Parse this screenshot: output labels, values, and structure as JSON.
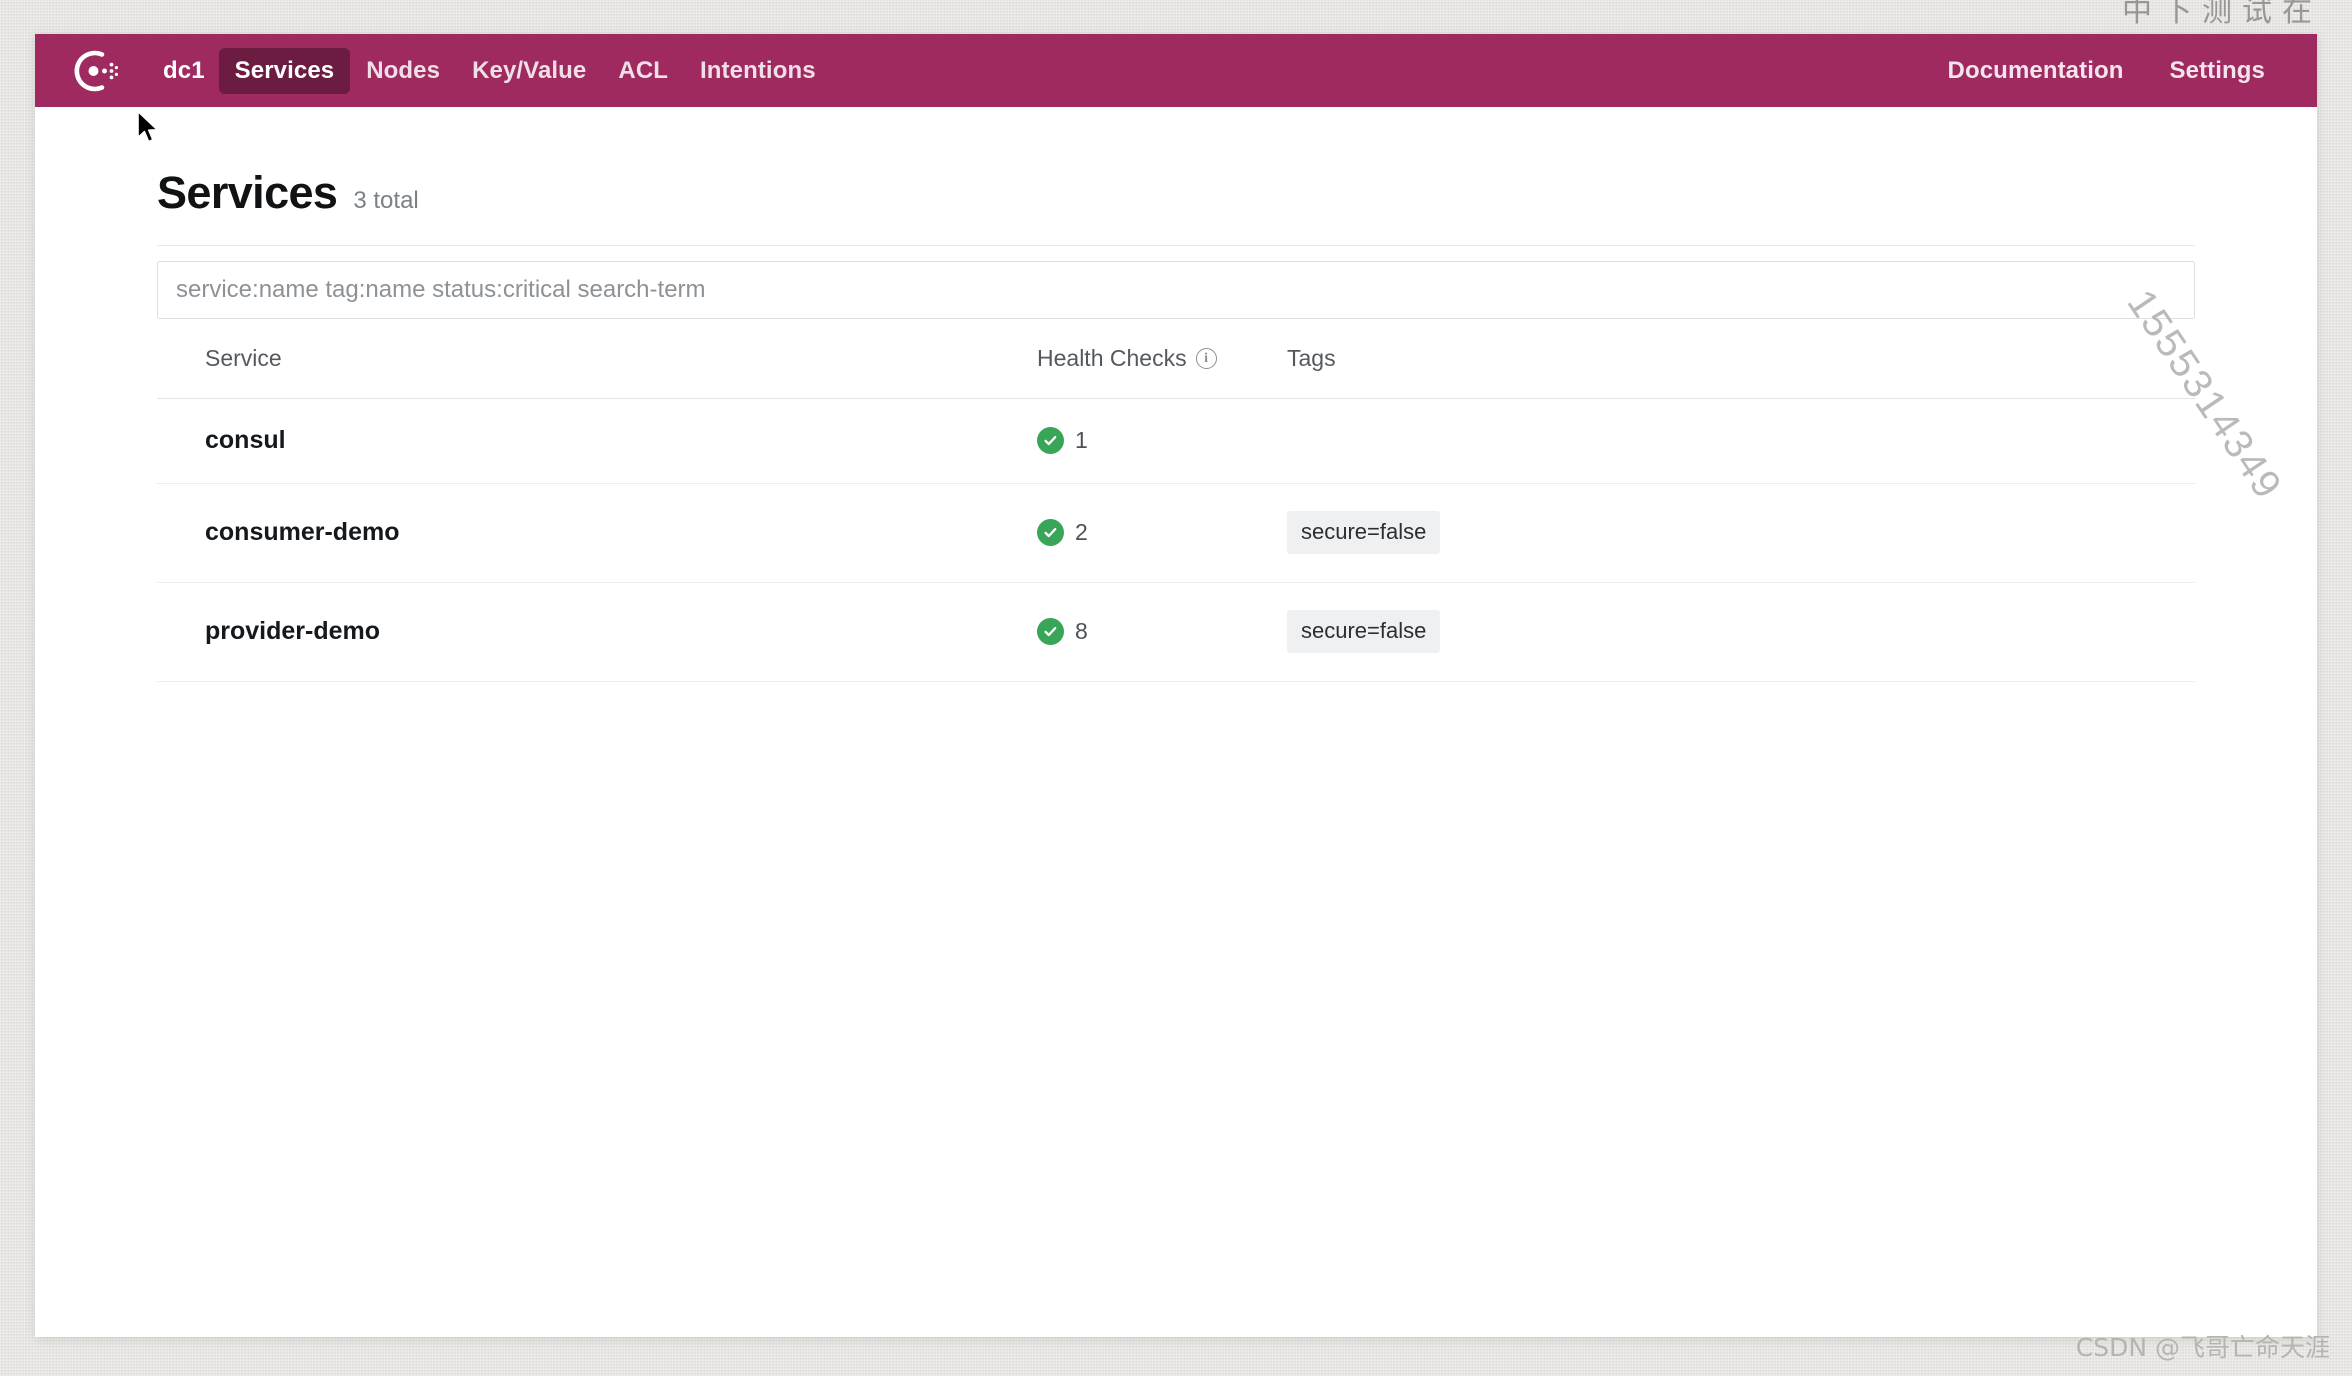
{
  "desktop": {
    "top_cutoff_text": "中下测试在",
    "watermark_diagonal": "1555314349",
    "watermark_footer": "CSDN @飞哥亡命天涯",
    "background_color": "#e3e1dd"
  },
  "navbar": {
    "brand_icon": "consul-logo-icon",
    "background_color": "#9e2a5f",
    "active_background_color": "#6d1c41",
    "datacenter": "dc1",
    "items": [
      {
        "label": "Services",
        "active": true
      },
      {
        "label": "Nodes",
        "active": false
      },
      {
        "label": "Key/Value",
        "active": false
      },
      {
        "label": "ACL",
        "active": false
      },
      {
        "label": "Intentions",
        "active": false
      }
    ],
    "right_items": [
      {
        "label": "Documentation"
      },
      {
        "label": "Settings"
      }
    ]
  },
  "page": {
    "title": "Services",
    "total": "3 total"
  },
  "search": {
    "value": "",
    "placeholder": "service:name tag:name status:critical search-term"
  },
  "table": {
    "headers": {
      "service": "Service",
      "health_checks": "Health Checks",
      "health_info_icon": "info-icon",
      "tags": "Tags"
    },
    "rows": [
      {
        "service": "consul",
        "health_status": "passing",
        "health_count": "1",
        "tags": []
      },
      {
        "service": "consumer-demo",
        "health_status": "passing",
        "health_count": "2",
        "tags": [
          "secure=false"
        ]
      },
      {
        "service": "provider-demo",
        "health_status": "passing",
        "health_count": "8",
        "tags": [
          "secure=false"
        ]
      }
    ]
  },
  "colors": {
    "brand": "#9e2a5f",
    "brand_dark": "#6d1c41",
    "health_passing": "#38a558"
  }
}
